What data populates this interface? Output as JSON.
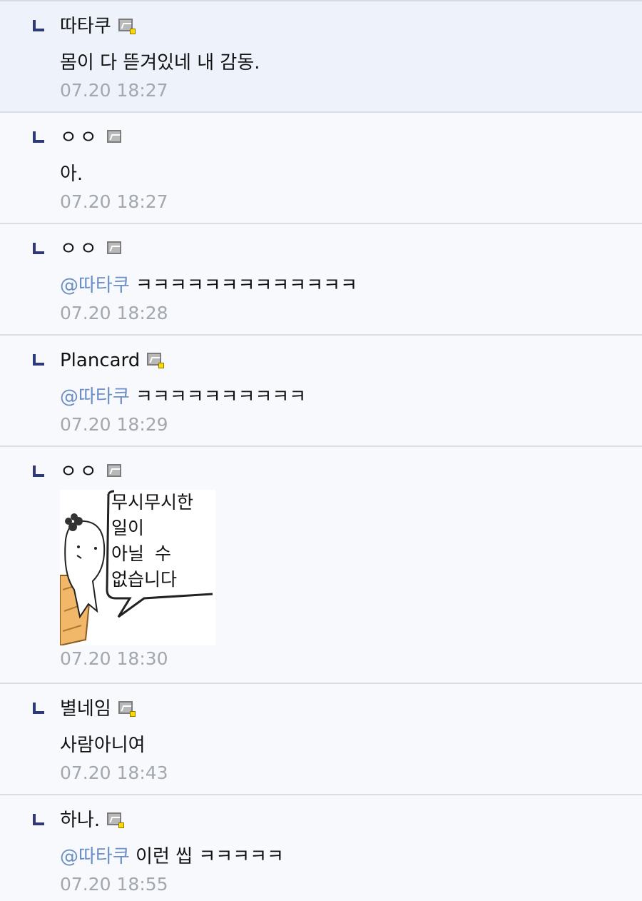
{
  "comments": [
    {
      "author": "따타쿠",
      "text": "몸이 다 뜯겨있네 내 감동.",
      "mention": "",
      "time": "07.20 18:27"
    },
    {
      "author": "ㅇㅇ",
      "text": "아.",
      "mention": "",
      "time": "07.20 18:27"
    },
    {
      "author": "ㅇㅇ",
      "mention": "@따타쿠",
      "text": "ㅋㅋㅋㅋㅋㅋㅋㅋㅋㅋㅋㅋㅋ",
      "time": "07.20 18:28"
    },
    {
      "author": "Plancard",
      "mention": "@따타쿠",
      "text": "ㅋㅋㅋㅋㅋㅋㅋㅋㅋㅋ",
      "time": "07.20 18:29"
    },
    {
      "author": "ㅇㅇ",
      "sticker": {
        "line1": "무시무시한",
        "line2": "일이",
        "line3": "아닐 수",
        "line4": "없습니다"
      },
      "time": "07.20 18:30"
    },
    {
      "author": "별네임",
      "text": "사람아니여",
      "mention": "",
      "time": "07.20 18:43"
    },
    {
      "author": "하나.",
      "mention": "@따타쿠",
      "text": "이런 씹 ㅋㅋㅋㅋㅋ",
      "time": "07.20 18:55"
    }
  ],
  "colors": {
    "mention": "#6b8fc4",
    "timestamp": "#a3a7ae",
    "reply_mark": "#2e3a78",
    "highlight_bg": "#edf2fb"
  },
  "icons": {
    "reply": "reply-arrow-icon",
    "member": "member-gallery-icon"
  }
}
